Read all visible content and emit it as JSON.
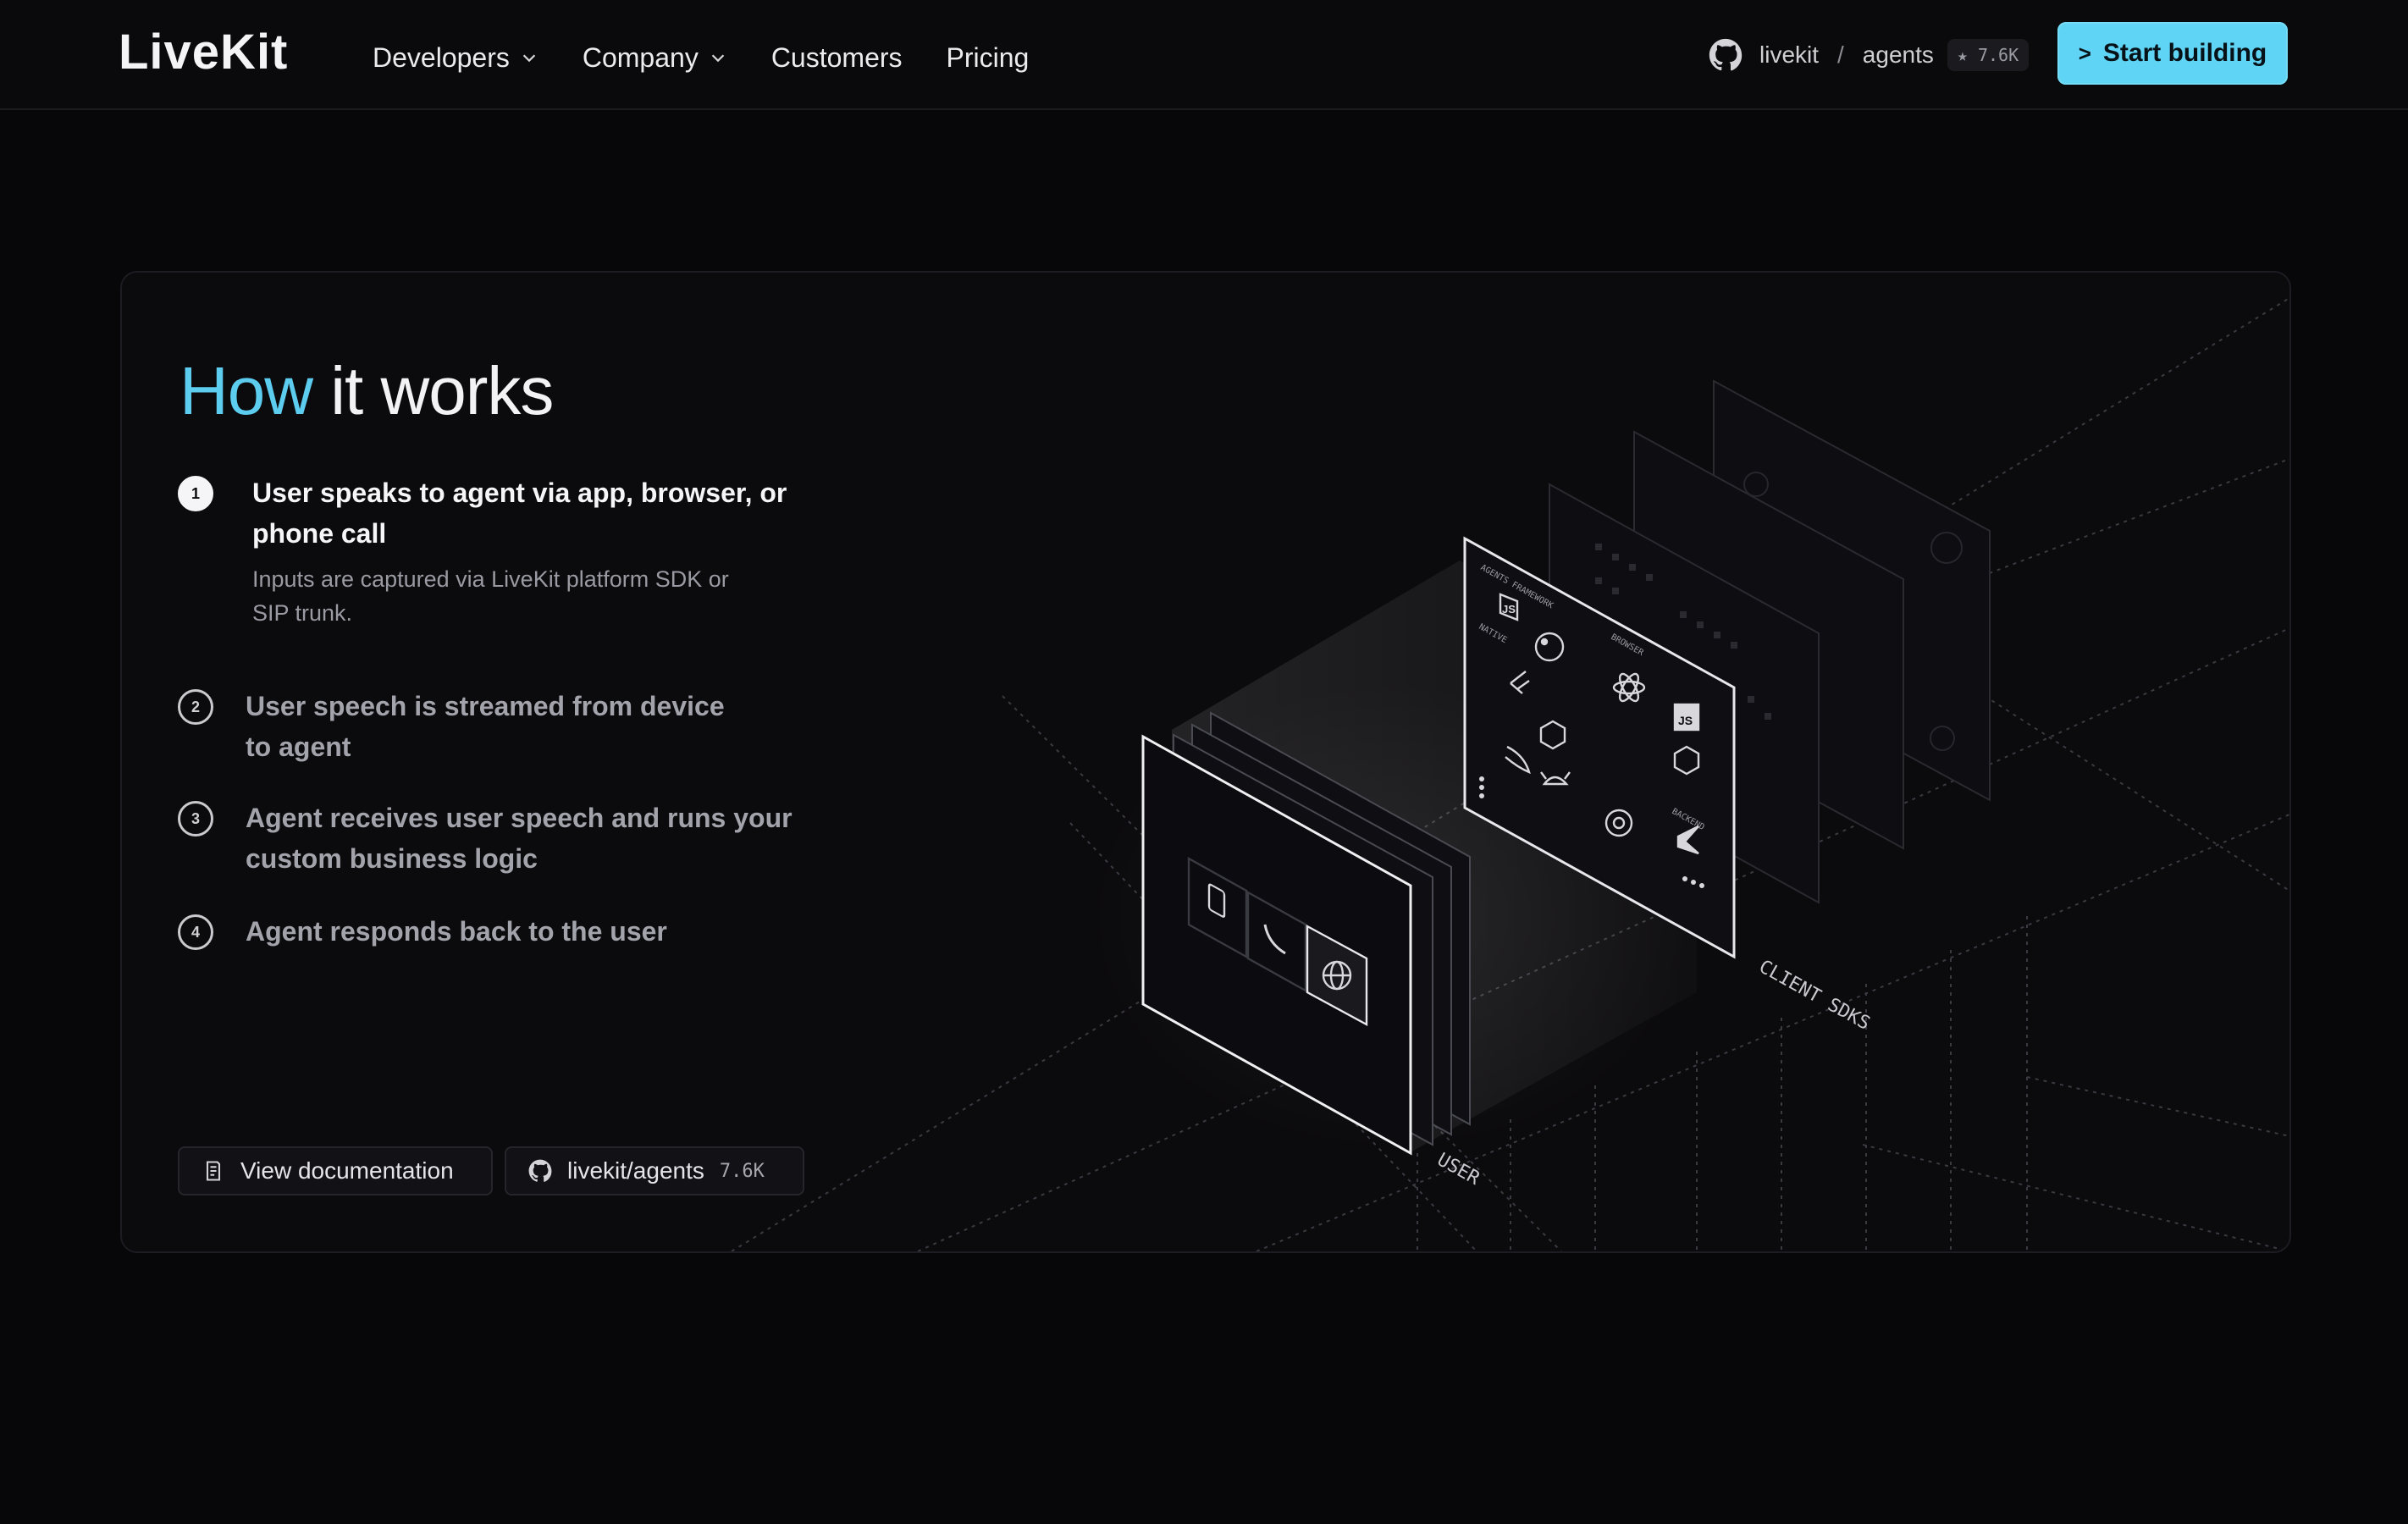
{
  "nav": {
    "logo": "LiveKit",
    "items": [
      {
        "label": "Developers",
        "has_dropdown": true
      },
      {
        "label": "Company",
        "has_dropdown": true
      },
      {
        "label": "Customers",
        "has_dropdown": false
      },
      {
        "label": "Pricing",
        "has_dropdown": false
      }
    ],
    "github": {
      "org": "livekit",
      "sep": "/",
      "repo": "agents",
      "stars": "★ 7.6K"
    },
    "cta_label": "Start building",
    "cta_icon": ">"
  },
  "section": {
    "heading_accent": "How",
    "heading_rest": " it works",
    "steps": [
      {
        "num": "1",
        "title_line1": "User speaks to agent via app, browser, or",
        "title_line2": "phone call",
        "desc_line1": "Inputs are captured via LiveKit platform SDK or",
        "desc_line2": "SIP trunk."
      },
      {
        "num": "2",
        "title_line1": "User speech is streamed from device",
        "title_line2": "to agent"
      },
      {
        "num": "3",
        "title_line1": "Agent receives user speech and runs your",
        "title_line2": "custom business logic"
      },
      {
        "num": "4",
        "title_line1": "Agent responds back to the user"
      }
    ],
    "buttons": {
      "docs_label": "View documentation",
      "repo_label": "livekit/agents",
      "repo_stars": "7.6K"
    }
  },
  "illustration": {
    "label_user": "USER",
    "label_client_sdks": "CLIENT SDKS",
    "panel_labels": {
      "framework": "AGENTS FRAMEWORK",
      "native": "NATIVE",
      "browser": "BROWSER",
      "backend": "BACKEND"
    },
    "sdk_icons": [
      "js-icon",
      "python-icon",
      "react-icon",
      "flutter-icon",
      "unity-icon",
      "js-square-icon",
      "swift-icon",
      "android-icon",
      "unity-icon",
      "rust-icon",
      "kotlin-icon"
    ],
    "device_icons": [
      "phone-device-icon",
      "phone-call-icon",
      "globe-icon"
    ]
  }
}
